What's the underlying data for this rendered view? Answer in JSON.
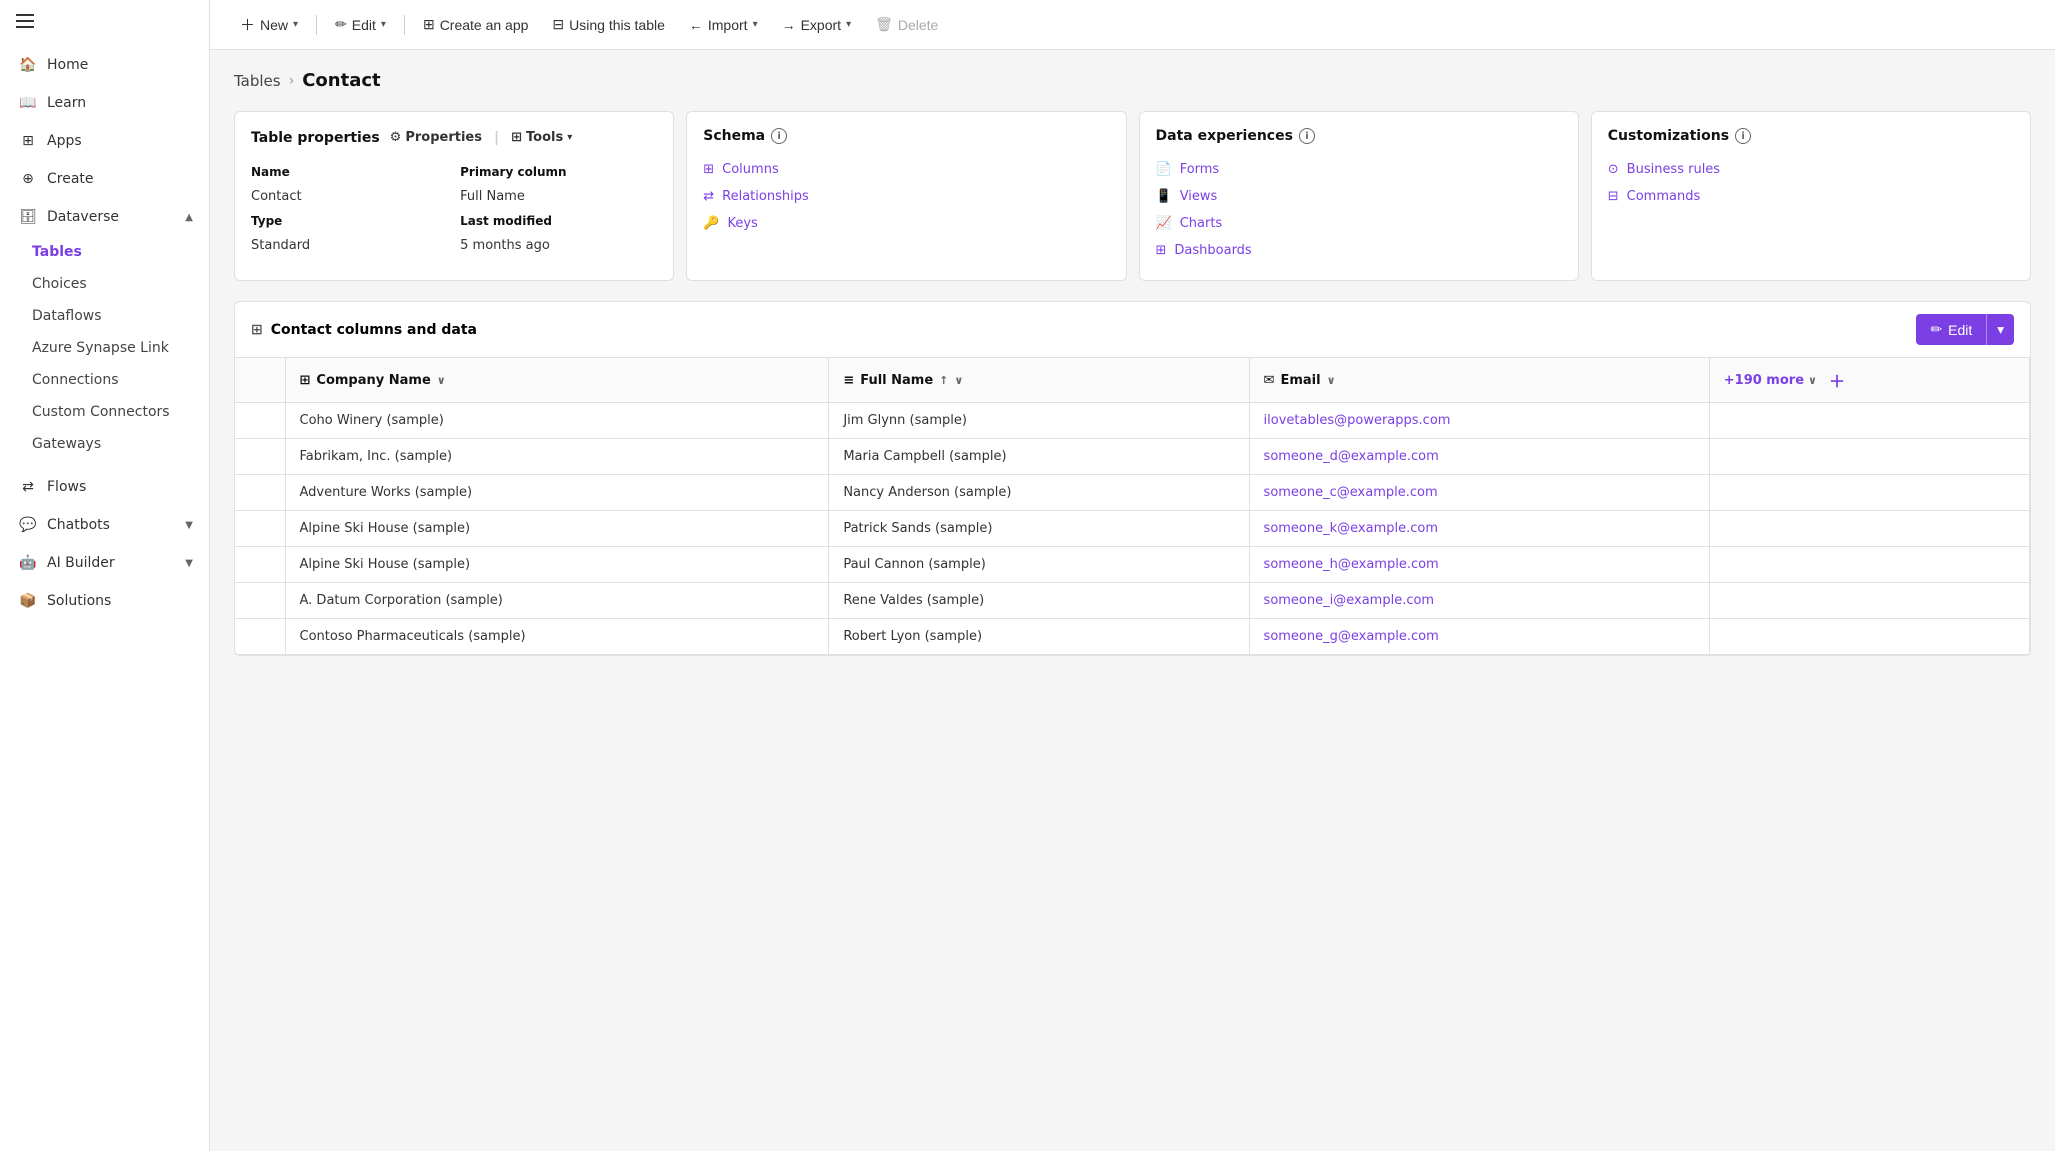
{
  "sidebar": {
    "items": [
      {
        "id": "home",
        "label": "Home",
        "icon": "home"
      },
      {
        "id": "learn",
        "label": "Learn",
        "icon": "book"
      },
      {
        "id": "apps",
        "label": "Apps",
        "icon": "grid"
      },
      {
        "id": "create",
        "label": "Create",
        "icon": "plus-circle"
      },
      {
        "id": "dataverse",
        "label": "Dataverse",
        "icon": "database",
        "expandable": true,
        "expanded": true
      }
    ],
    "dataverse_children": [
      {
        "id": "tables",
        "label": "Tables",
        "active": true
      },
      {
        "id": "choices",
        "label": "Choices"
      },
      {
        "id": "dataflows",
        "label": "Dataflows"
      },
      {
        "id": "azure_synapse",
        "label": "Azure Synapse Link"
      },
      {
        "id": "connections",
        "label": "Connections"
      },
      {
        "id": "custom_connectors",
        "label": "Custom Connectors"
      },
      {
        "id": "gateways",
        "label": "Gateways"
      }
    ],
    "bottom_items": [
      {
        "id": "flows",
        "label": "Flows",
        "icon": "flow"
      },
      {
        "id": "chatbots",
        "label": "Chatbots",
        "icon": "chatbot",
        "expandable": true
      },
      {
        "id": "ai_builder",
        "label": "AI Builder",
        "icon": "ai",
        "expandable": true
      },
      {
        "id": "solutions",
        "label": "Solutions",
        "icon": "solutions"
      }
    ]
  },
  "toolbar": {
    "new_label": "New",
    "edit_label": "Edit",
    "create_app_label": "Create an app",
    "using_table_label": "Using this table",
    "import_label": "Import",
    "export_label": "Export",
    "delete_label": "Delete"
  },
  "breadcrumb": {
    "parent": "Tables",
    "current": "Contact"
  },
  "table_properties": {
    "title": "Table properties",
    "properties_btn": "Properties",
    "tools_btn": "Tools",
    "name_label": "Name",
    "name_value": "Contact",
    "type_label": "Type",
    "type_value": "Standard",
    "primary_column_label": "Primary column",
    "primary_column_value": "Full Name",
    "last_modified_label": "Last modified",
    "last_modified_value": "5 months ago"
  },
  "schema": {
    "title": "Schema",
    "links": [
      {
        "id": "columns",
        "label": "Columns",
        "icon": "columns"
      },
      {
        "id": "relationships",
        "label": "Relationships",
        "icon": "relationships"
      },
      {
        "id": "keys",
        "label": "Keys",
        "icon": "keys"
      }
    ]
  },
  "data_experiences": {
    "title": "Data experiences",
    "links": [
      {
        "id": "forms",
        "label": "Forms",
        "icon": "forms"
      },
      {
        "id": "views",
        "label": "Views",
        "icon": "views"
      },
      {
        "id": "charts",
        "label": "Charts",
        "icon": "charts"
      },
      {
        "id": "dashboards",
        "label": "Dashboards",
        "icon": "dashboards"
      }
    ]
  },
  "customizations": {
    "title": "Customizations",
    "links": [
      {
        "id": "business_rules",
        "label": "Business rules",
        "icon": "business-rules"
      },
      {
        "id": "commands",
        "label": "Commands",
        "icon": "commands"
      }
    ]
  },
  "data_table": {
    "title": "Contact columns and data",
    "edit_btn": "Edit",
    "columns": [
      {
        "id": "company",
        "label": "Company Name",
        "type": "table",
        "sortable": true
      },
      {
        "id": "fullname",
        "label": "Full Name",
        "type": "text",
        "sortable": true,
        "sorted": "asc"
      },
      {
        "id": "email",
        "label": "Email",
        "type": "email",
        "sortable": true
      }
    ],
    "more_cols": "+190 more",
    "rows": [
      {
        "company": "Coho Winery (sample)",
        "fullname": "Jim Glynn (sample)",
        "email": "ilovetables@powerapps.com"
      },
      {
        "company": "Fabrikam, Inc. (sample)",
        "fullname": "Maria Campbell (sample)",
        "email": "someone_d@example.com"
      },
      {
        "company": "Adventure Works (sample)",
        "fullname": "Nancy Anderson (sample)",
        "email": "someone_c@example.com"
      },
      {
        "company": "Alpine Ski House (sample)",
        "fullname": "Patrick Sands (sample)",
        "email": "someone_k@example.com"
      },
      {
        "company": "Alpine Ski House (sample)",
        "fullname": "Paul Cannon (sample)",
        "email": "someone_h@example.com"
      },
      {
        "company": "A. Datum Corporation (sample)",
        "fullname": "Rene Valdes (sample)",
        "email": "someone_i@example.com"
      },
      {
        "company": "Contoso Pharmaceuticals (sample)",
        "fullname": "Robert Lyon (sample)",
        "email": "someone_g@example.com"
      }
    ]
  }
}
